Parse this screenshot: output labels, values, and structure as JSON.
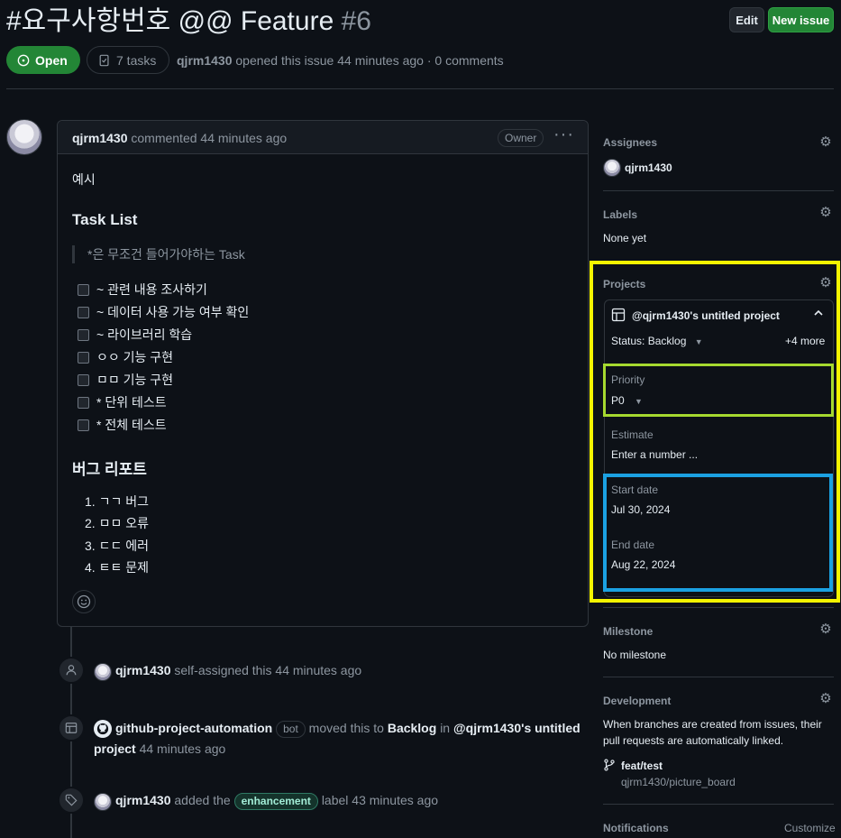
{
  "issue": {
    "title": "#요구사항번호 @@ Feature",
    "number": "#6",
    "state": "Open",
    "tasks": "7 tasks",
    "author": "qjrm1430",
    "meta": "opened this issue 44 minutes ago · 0 comments"
  },
  "header": {
    "edit_label": "Edit",
    "new_issue_label": "New issue"
  },
  "comment": {
    "author": "qjrm1430",
    "when": "commented 44 minutes ago",
    "owner_badge": "Owner",
    "menu": "···",
    "intro": "예시",
    "task_heading": "Task List",
    "quote": "*은 무조건 들어가야하는 Task",
    "tasks": [
      "~ 관련 내용 조사하기",
      "~ 데이터 사용 가능 여부 확인",
      "~ 라이브러리 학습",
      "ㅇㅇ 기능 구현",
      "ㅁㅁ 기능 구현",
      "* 단위 테스트",
      "* 전체 테스트"
    ],
    "bug_heading": "버그 리포트",
    "bugs": [
      "1. ㄱㄱ 버그",
      "2. ㅁㅁ 오류",
      "3. ㄷㄷ 에러",
      "4. ㅌㅌ 문제"
    ]
  },
  "timeline": [
    {
      "actor": "qjrm1430",
      "text": "self-assigned this 44 minutes ago"
    },
    {
      "actor": "github-project-automation",
      "badge": "bot",
      "text1": "moved this to",
      "column": "Backlog",
      "text2": "in",
      "project_a": "@qjrm1430's untitled",
      "project_b": "project",
      "when": "44 minutes ago"
    },
    {
      "actor": "qjrm1430",
      "text1": "added the",
      "label": "enhancement",
      "text2": "label 43 minutes ago"
    }
  ],
  "sidebar": {
    "assignees": {
      "heading": "Assignees",
      "value": "qjrm1430"
    },
    "labels": {
      "heading": "Labels",
      "value": "None yet"
    },
    "projects": {
      "heading": "Projects",
      "project_name": "@qjrm1430's untitled project",
      "status": "Status: Backlog",
      "more": "+4 more",
      "priority_label": "Priority",
      "priority_value": "P0",
      "estimate_label": "Estimate",
      "estimate_value": "Enter a number ...",
      "start_label": "Start date",
      "start_value": "Jul 30, 2024",
      "end_label": "End date",
      "end_value": "Aug 22, 2024"
    },
    "milestone": {
      "heading": "Milestone",
      "value": "No milestone"
    },
    "development": {
      "heading": "Development",
      "desc1": "When branches are created from issues, their",
      "desc2": "pull requests are automatically linked.",
      "branch": "feat/test",
      "repo": "qjrm1430/picture_board"
    },
    "notifications": {
      "heading": "Notifications",
      "customize": "Customize"
    }
  }
}
